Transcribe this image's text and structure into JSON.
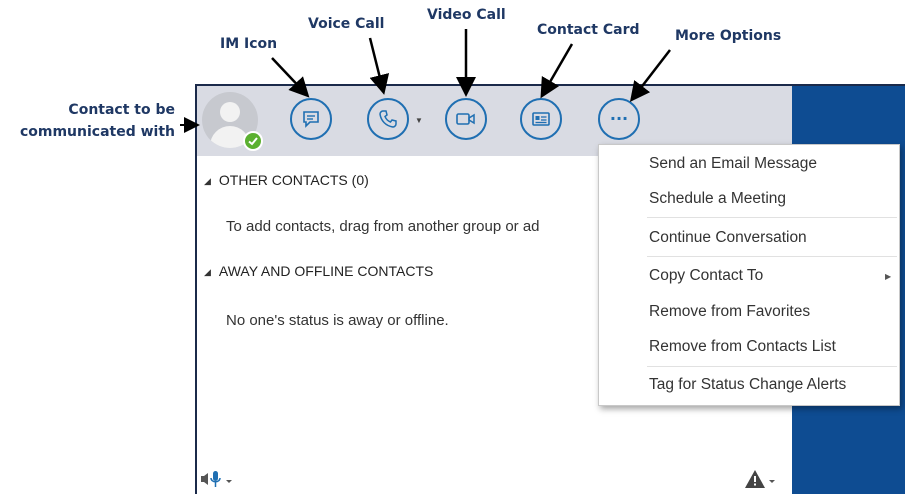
{
  "callouts": {
    "contact_line1": "Contact to be",
    "contact_line2": "communicated with",
    "im_icon": "IM Icon",
    "voice_call": "Voice Call",
    "video_call": "Video Call",
    "contact_card": "Contact Card",
    "more_options": "More Options"
  },
  "toolbar": {
    "icons": [
      "im-icon",
      "phone-icon",
      "video-icon",
      "contact-card-icon",
      "more-options-icon"
    ],
    "more_options_glyph": "···"
  },
  "groups": [
    {
      "title": "OTHER CONTACTS (0)",
      "message": "To add contacts, drag from another group or ad"
    },
    {
      "title": "AWAY AND OFFLINE CONTACTS",
      "message": "No one's status is away or offline."
    }
  ],
  "context_menu": {
    "items": [
      "Send an Email Message",
      "Schedule a Meeting",
      "Continue Conversation",
      "Copy Contact To",
      "Remove from Favorites",
      "Remove from Contacts List",
      "Tag for Status Change Alerts"
    ]
  },
  "colors": {
    "accent": "#1f6fb2",
    "callout_text": "#1f3864",
    "sidebar_blue": "#0e4c92",
    "presence_green": "#5bb030"
  }
}
